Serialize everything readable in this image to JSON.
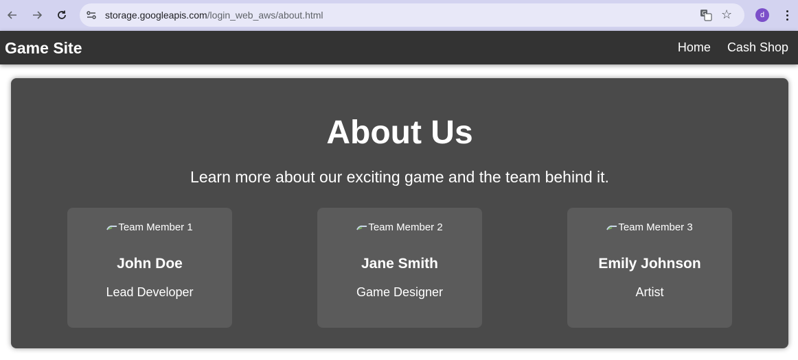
{
  "browser": {
    "url_host": "storage.googleapis.com",
    "url_path": "/login_web_aws/about.html",
    "profile_initial": "d",
    "profile_color": "#7b4fc9"
  },
  "site": {
    "title": "Game Site",
    "nav": [
      {
        "label": "Home"
      },
      {
        "label": "Cash Shop"
      }
    ]
  },
  "about": {
    "heading": "About Us",
    "subtitle": "Learn more about our exciting game and the team behind it.",
    "team": [
      {
        "image_alt": "Team Member 1",
        "name": "John Doe",
        "role": "Lead Developer"
      },
      {
        "image_alt": "Team Member 2",
        "name": "Jane Smith",
        "role": "Game Designer"
      },
      {
        "image_alt": "Team Member 3",
        "name": "Emily Johnson",
        "role": "Artist"
      }
    ]
  },
  "colors": {
    "chrome_bg": "#d3d3f0",
    "header_bg": "#333333",
    "panel_bg": "#4a4a4a",
    "card_bg": "#5b5b5b"
  }
}
